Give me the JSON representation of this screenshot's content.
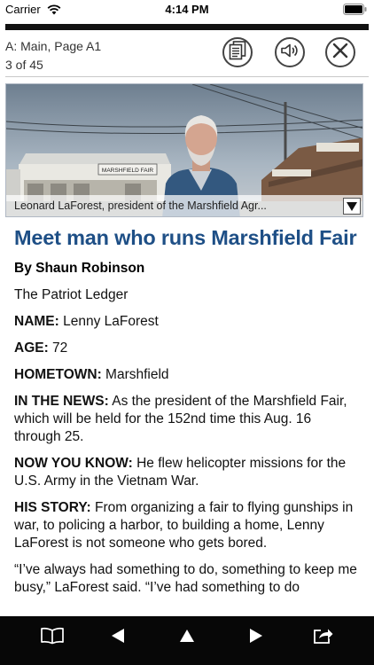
{
  "status_bar": {
    "carrier": "Carrier",
    "time": "4:14 PM"
  },
  "header": {
    "section": "A: Main, Page A1",
    "page_count": "3 of 45"
  },
  "photo": {
    "caption": "Leonard LaForest, president of the Marshfield Agr...",
    "sign_text": "MARSHFIELD FAIR"
  },
  "article": {
    "headline": "Meet man who runs Marshfield Fair",
    "byline": "By Shaun Robinson",
    "source": "The Patriot Ledger",
    "fields": [
      {
        "label": "NAME:",
        "value": " Lenny LaForest"
      },
      {
        "label": "AGE:",
        "value": " 72"
      },
      {
        "label": "HOMETOWN:",
        "value": " Marshfield"
      },
      {
        "label": "IN THE NEWS:",
        "value": " As the president of the Marshfield Fair, which will be held for the 152nd time this Aug. 16 through 25."
      },
      {
        "label": "NOW YOU KNOW:",
        "value": " He flew helicopter missions for the U.S. Army in the Vietnam War."
      },
      {
        "label": "HIS STORY:",
        "value": " From organizing a fair to flying gunships in war, to policing a harbor, to building a home, Lenny LaForest is not someone who gets bored."
      }
    ],
    "quote": "“I’ve always had something to do, something to keep me busy,” LaForest said. “I’ve had something to do"
  },
  "colors": {
    "headline": "#1e4f86",
    "toolbar": "#070707"
  },
  "icons": {
    "header": [
      "pages-icon",
      "speaker-icon",
      "close-icon"
    ],
    "toolbar": [
      "book-icon",
      "previous-icon",
      "up-icon",
      "next-icon",
      "share-icon"
    ]
  }
}
